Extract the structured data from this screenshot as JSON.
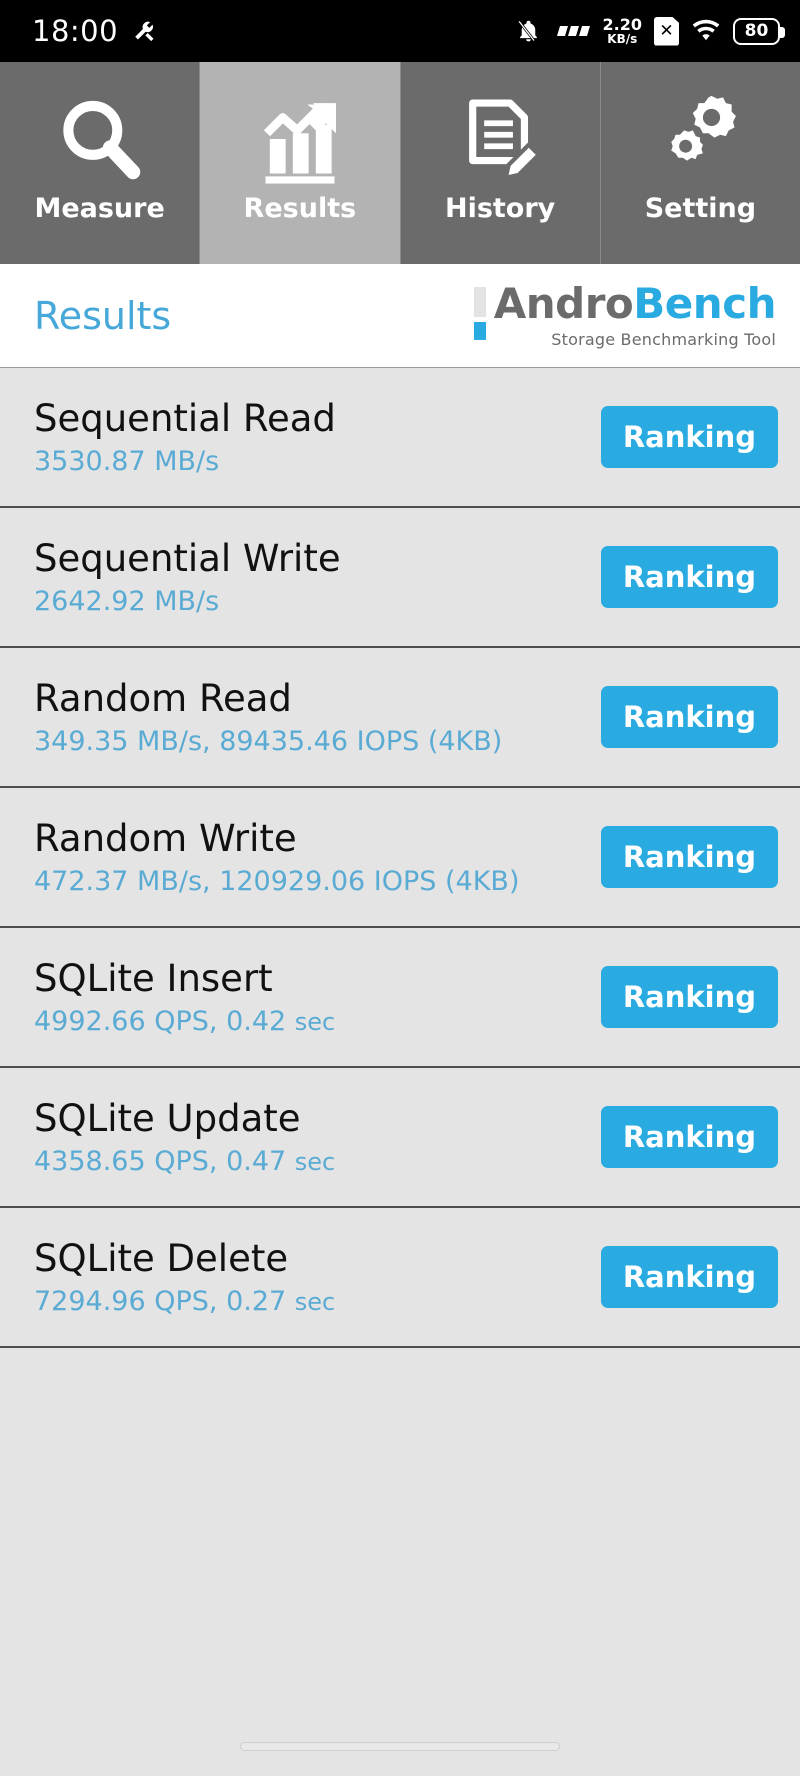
{
  "statusbar": {
    "clock": "18:00",
    "dev_icon": "developer-options-icon",
    "mute_icon": "notifications-silenced-icon",
    "signal_icon": "signal-bars-icon",
    "net_speed_value": "2.20",
    "net_speed_unit": "KB/s",
    "sim_icon_label": "✕",
    "wifi_icon": "wifi-icon",
    "battery_level": "80"
  },
  "tabs": [
    {
      "label": "Measure",
      "icon": "magnifier-icon",
      "active": false
    },
    {
      "label": "Results",
      "icon": "bar-chart-arrow-icon",
      "active": true
    },
    {
      "label": "History",
      "icon": "document-pencil-icon",
      "active": false
    },
    {
      "label": "Setting",
      "icon": "gears-icon",
      "active": false
    }
  ],
  "header": {
    "title": "Results",
    "logo_andro": "Andro",
    "logo_bench": "Bench",
    "logo_tagline": "Storage Benchmarking Tool"
  },
  "results": {
    "ranking_label": "Ranking",
    "rows": [
      {
        "title": "Sequential Read",
        "value": "3530.87 MB/s",
        "unit_small": ""
      },
      {
        "title": "Sequential Write",
        "value": "2642.92 MB/s",
        "unit_small": ""
      },
      {
        "title": "Random Read",
        "value": "349.35 MB/s, 89435.46 IOPS (4KB)",
        "unit_small": ""
      },
      {
        "title": "Random Write",
        "value": "472.37 MB/s, 120929.06 IOPS (4KB)",
        "unit_small": ""
      },
      {
        "title": "SQLite Insert",
        "value": "4992.66 QPS, 0.42 ",
        "unit_small": "sec"
      },
      {
        "title": "SQLite Update",
        "value": "4358.65 QPS, 0.47 ",
        "unit_small": "sec"
      },
      {
        "title": "SQLite Delete",
        "value": "7294.96 QPS, 0.27 ",
        "unit_small": "sec"
      }
    ]
  },
  "colors": {
    "accent_blue": "#29abe2",
    "value_blue": "#5aabd4",
    "tab_inactive": "#6b6b6b",
    "tab_active": "#b3b3b3",
    "list_bg": "#e4e4e4"
  }
}
